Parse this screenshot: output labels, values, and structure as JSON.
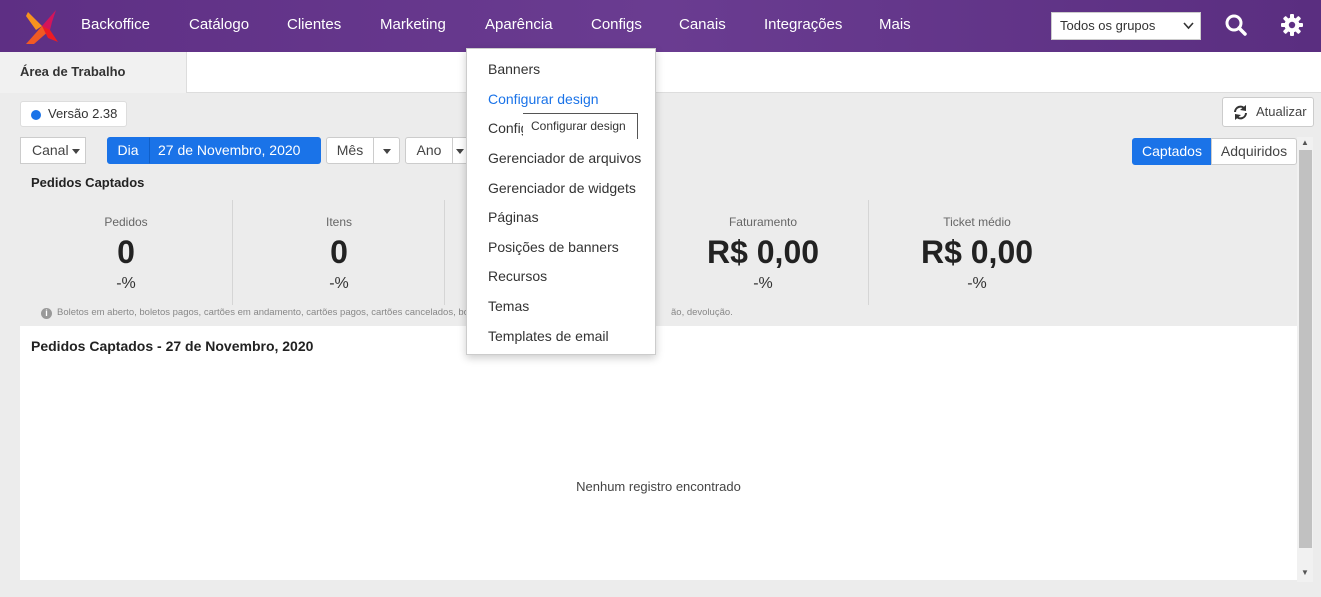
{
  "nav": {
    "items": [
      "Backoffice",
      "Catálogo",
      "Clientes",
      "Marketing",
      "Aparência",
      "Configs",
      "Canais",
      "Integrações",
      "Mais"
    ],
    "group_select": "Todos os grupos"
  },
  "tabs": {
    "active": "Área de Trabalho"
  },
  "version": "Versão 2.38",
  "refresh_label": "Atualizar",
  "filters": {
    "canal": "Canal",
    "dia": "Dia",
    "date": "27 de Novembro, 2020",
    "mes": "Mês",
    "ano": "Ano",
    "captados": "Captados",
    "adquiridos": "Adquiridos"
  },
  "summary": {
    "title": "Pedidos Captados",
    "stats": [
      {
        "label": "Pedidos",
        "value": "0",
        "pct": "-%"
      },
      {
        "label": "Itens",
        "value": "0",
        "pct": "-%"
      },
      {
        "label": "Faturamento",
        "value": "R$ 0,00",
        "pct": "-%"
      },
      {
        "label": "Ticket médio",
        "value": "R$ 0,00",
        "pct": "-%"
      }
    ],
    "note_left": "Boletos em aberto, boletos pagos, cartões em andamento, cartões pagos, cartões cancelados, bo",
    "note_right": "ão, devolução."
  },
  "chart": {
    "title": "Pedidos Captados - 27 de Novembro, 2020",
    "empty": "Nenhum registro encontrado"
  },
  "dropdown": {
    "items": [
      "Banners",
      "Configurar design",
      "Config",
      "Gerenciador de arquivos",
      "Gerenciador de widgets",
      "Páginas",
      "Posições de banners",
      "Recursos",
      "Temas",
      "Templates de email"
    ],
    "tooltip": "Configurar design"
  },
  "colors": {
    "nav": "#5e2f84",
    "accent": "#1a73e8",
    "logo_orange": "#f15a24",
    "logo_red": "#d4145a"
  }
}
